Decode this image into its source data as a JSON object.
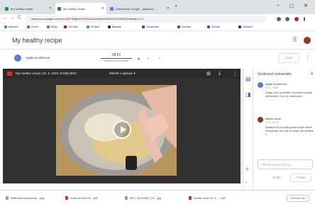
{
  "browser": {
    "tabs": [
      {
        "label": "My healthy recipe",
        "icon": "classroom-icon"
      },
      {
        "label": "My healthy recipe",
        "icon": "classroom-icon"
      },
      {
        "label": "Dokumenty Google - jazykova...",
        "icon": "docs-icon"
      }
    ],
    "new_tab": "+",
    "window_controls": {
      "minimize": "–",
      "maximize": "▢",
      "close": "✕"
    },
    "nav": {
      "back": "←",
      "forward": "→",
      "reload": "C"
    },
    "url": "classroom.google.com/u/1/c/MTI5MjkxNTE4NzU4/sa/MzM3NDU2OTk5NDQ5/details?u=1",
    "bookmarks": [
      "Aplikace",
      "Gmail",
      "Mapy",
      "YouTube",
      "Preklad",
      "Bakalari",
      "Vocabulary",
      "Seznam",
      "Slovnik",
      "Zakladni"
    ]
  },
  "header": {
    "title": "My healthy recipe"
  },
  "filebar": {
    "owner": "Agáta Kostlerová",
    "page_value": "28:51",
    "page_label": "dokončeno ve formátu",
    "prev": "‹",
    "next": "›",
    "submit_label": "Vrátit",
    "more_icon": "more-icon"
  },
  "viewer": {
    "filename": "My healthy recipe (10. 6. 2021 10:08).MOV",
    "open_with": "Otevřít v aplikaci",
    "play_icon": "play-icon"
  },
  "comments": {
    "title": "Soukromé komentáře",
    "items": [
      {
        "name": "Agáta Kostlerová",
        "date": "10. 6., 10:46",
        "text": "Dobrý den, promiňte mi prosím pozdní odevzdání, moc se omlouvám."
      },
      {
        "name": "Marek Jaroš",
        "date": "20. 6., 15:11",
        "text": "Brilliant! It's a really great recipe which everybody can use to make the muffins :)"
      }
    ],
    "input_placeholder": "Přidejte soukromý ko...",
    "cancel_label": "Zrušit",
    "post_label": "Přidat"
  },
  "downloads": {
    "items": [
      "Stáhnout dokumenty....png",
      "Kontrolní test 10...pdf",
      "IMG_20210602_13....jpg",
      "Adobe Scan 10. 6. ....pdf"
    ],
    "show_all": "Zobrazit vše"
  },
  "colors": {
    "accent": "#1a73e8",
    "viewer_bg": "#323232"
  }
}
